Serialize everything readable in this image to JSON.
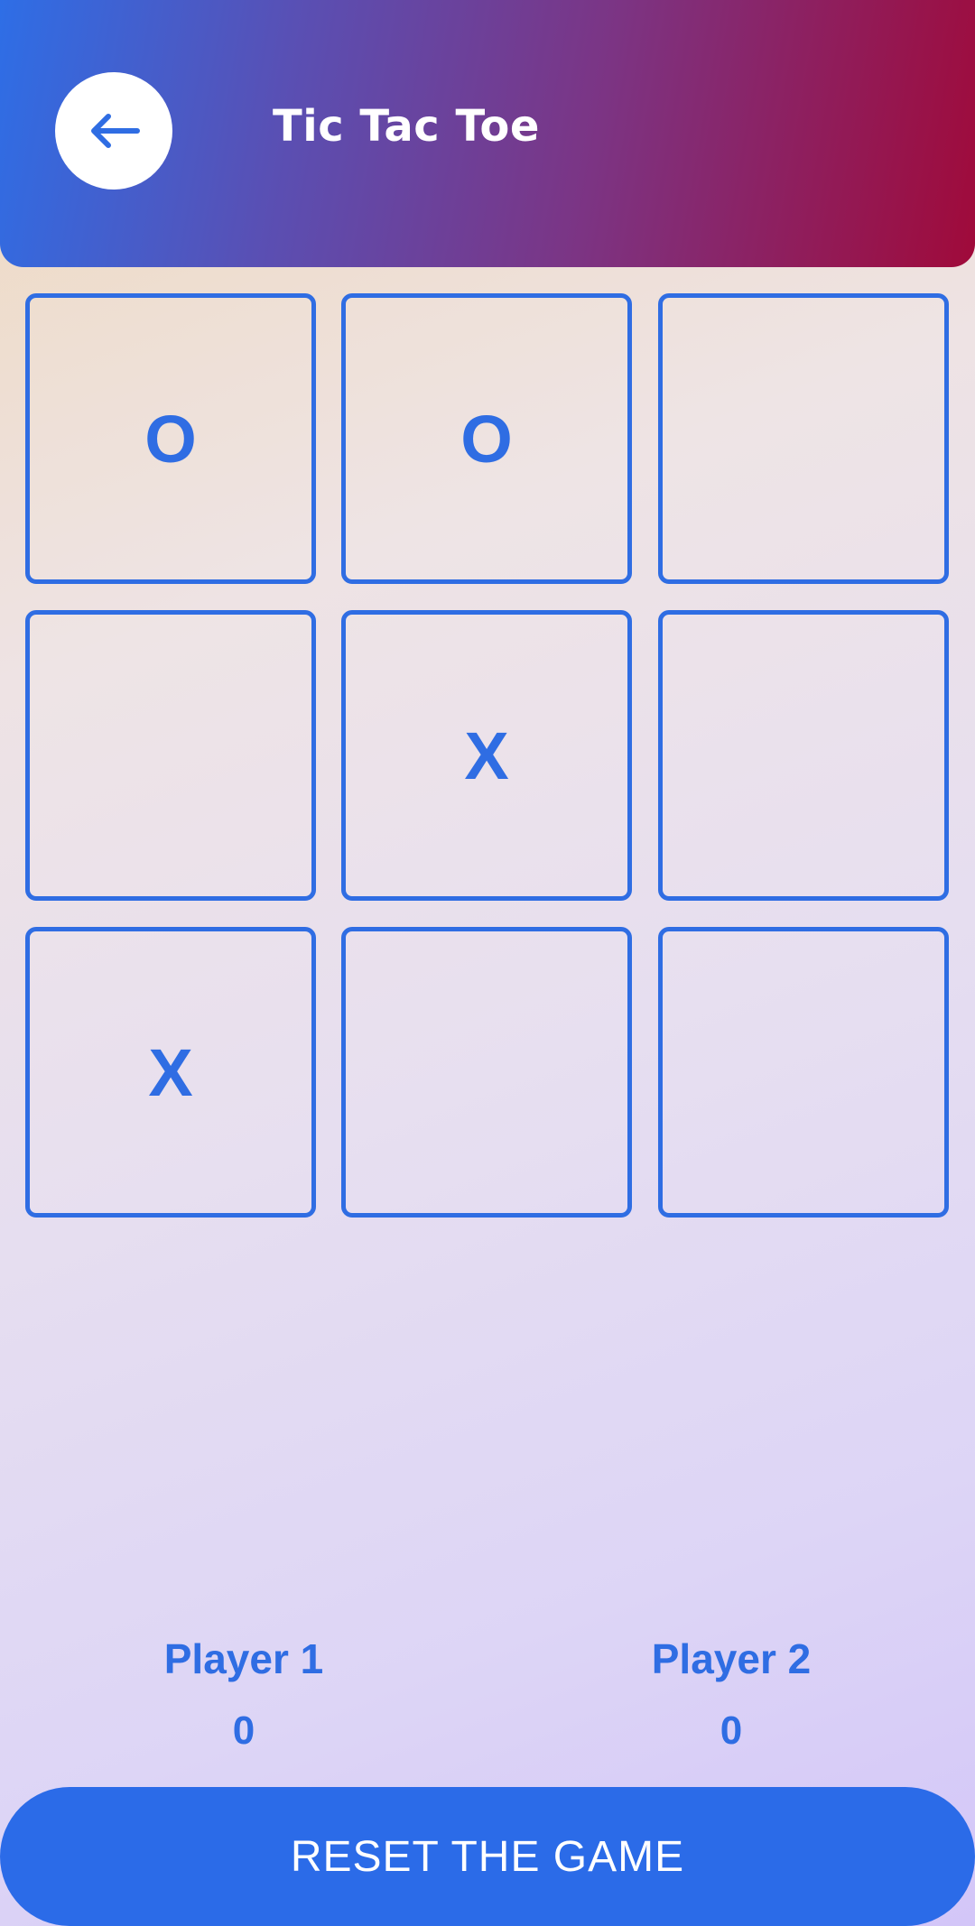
{
  "header": {
    "title": "Tic Tac Toe",
    "back_icon": "arrow-left-icon"
  },
  "board": {
    "cells": [
      "O",
      "O",
      "",
      "",
      "X",
      "",
      "X",
      "",
      ""
    ]
  },
  "players": [
    {
      "name": "Player 1",
      "score": "0"
    },
    {
      "name": "Player 2",
      "score": "0"
    }
  ],
  "reset_label": "RESET THE GAME",
  "colors": {
    "accent": "#2f6de3",
    "header_start": "#2e6ee6",
    "header_end": "#a00a3a"
  }
}
